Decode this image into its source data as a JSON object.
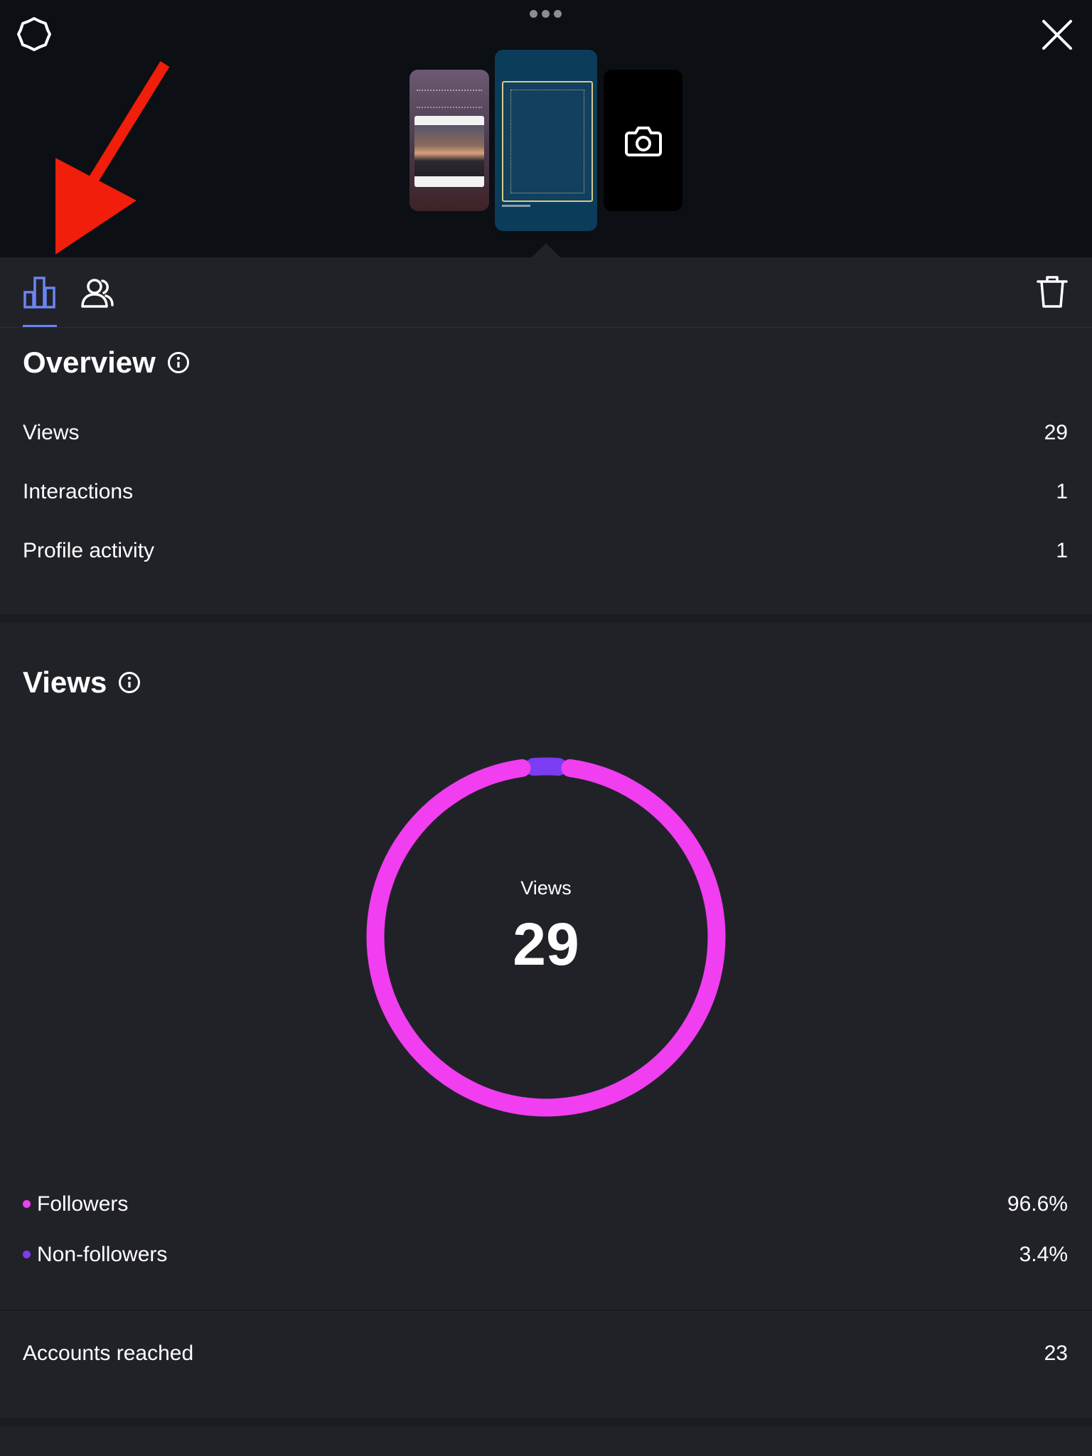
{
  "header": {
    "settings_icon": "gear-icon",
    "close_icon": "close-icon",
    "camera_icon": "camera-icon"
  },
  "tabs": {
    "items": [
      {
        "name": "insights",
        "icon": "bar-chart-icon",
        "active": true
      },
      {
        "name": "viewers",
        "icon": "people-icon",
        "active": false
      }
    ],
    "delete_icon": "trash-icon"
  },
  "overview": {
    "title": "Overview",
    "rows": [
      {
        "label": "Views",
        "value": "29"
      },
      {
        "label": "Interactions",
        "value": "1"
      },
      {
        "label": "Profile activity",
        "value": "1"
      }
    ]
  },
  "views": {
    "title": "Views",
    "center_label": "Views",
    "center_value": "29",
    "legend": [
      {
        "label": "Followers",
        "value": "96.6%",
        "color": "#f03ef0"
      },
      {
        "label": "Non-followers",
        "value": "3.4%",
        "color": "#7b3cf2"
      }
    ]
  },
  "chart_data": {
    "type": "pie",
    "categories": [
      "Followers",
      "Non-followers"
    ],
    "values": [
      96.6,
      3.4
    ],
    "colors": [
      "#f03ef0",
      "#7b3cf2"
    ]
  },
  "reach": {
    "label": "Accounts reached",
    "value": "23"
  },
  "colors": {
    "background": "#212228",
    "top_bar": "#0c0f14",
    "accent": "#6b86f2",
    "followers": "#f03ef0",
    "non_followers": "#7b3cf2",
    "annotation_arrow": "#f01e0a"
  }
}
